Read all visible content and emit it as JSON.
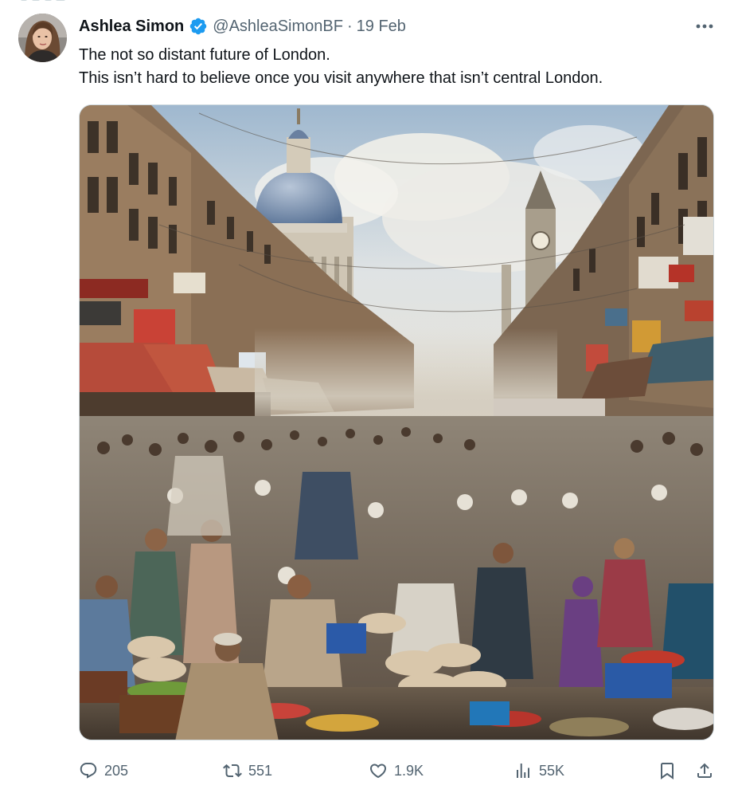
{
  "tweet": {
    "author_name": "Ashlea Simon",
    "handle": "@AshleaSimonBF",
    "separator": "·",
    "date": "19 Feb",
    "lines": [
      "The not so distant future of London.",
      "This isn’t hard to believe once you visit anywhere that isn’t central London."
    ],
    "verified_badge_color": "#1d9bf0",
    "image_alt": "AI-generated image of a crowded street market in London with St Paul's dome and a clock tower in the background"
  },
  "actions": {
    "replies": "205",
    "reposts": "551",
    "likes": "1.9K",
    "views": "55K"
  },
  "colors": {
    "text": "#0f1419",
    "muted": "#536471",
    "border": "#cfd9de",
    "accent": "#1d9bf0"
  }
}
